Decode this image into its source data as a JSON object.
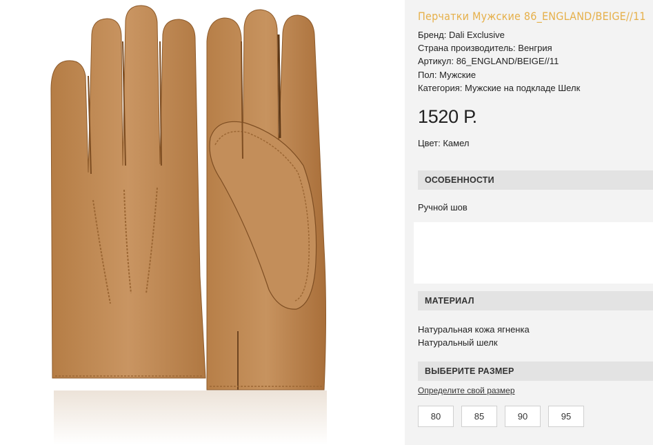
{
  "product": {
    "title": "Перчатки Мужские 86_ENGLAND/BEIGE//11",
    "specs": [
      "Бренд: Dali Exclusive",
      "Страна производитель: Венгрия",
      "Артикул: 86_ENGLAND/BEIGE//11",
      "Пол: Мужские",
      "Категория: Мужские на подкладе Шелк"
    ],
    "price": "1520 Р.",
    "color": "Цвет: Камел"
  },
  "features": {
    "heading": "ОСОБЕННОСТИ",
    "text": "Ручной шов"
  },
  "material": {
    "heading": "МАТЕРИАЛ",
    "items": [
      "Натуральная кожа ягненка",
      "Натуральный шелк"
    ]
  },
  "size": {
    "heading": "ВЫБЕРИТЕ РАЗМЕР",
    "link": "Определите свой размер",
    "options": [
      "80",
      "85",
      "90",
      "95"
    ]
  },
  "colors": {
    "title": "#e6b04a",
    "glove": "#c08a52",
    "glove_dark": "#9e6a36",
    "panel": "#f3f3f3",
    "section_head": "#e3e3e3"
  }
}
